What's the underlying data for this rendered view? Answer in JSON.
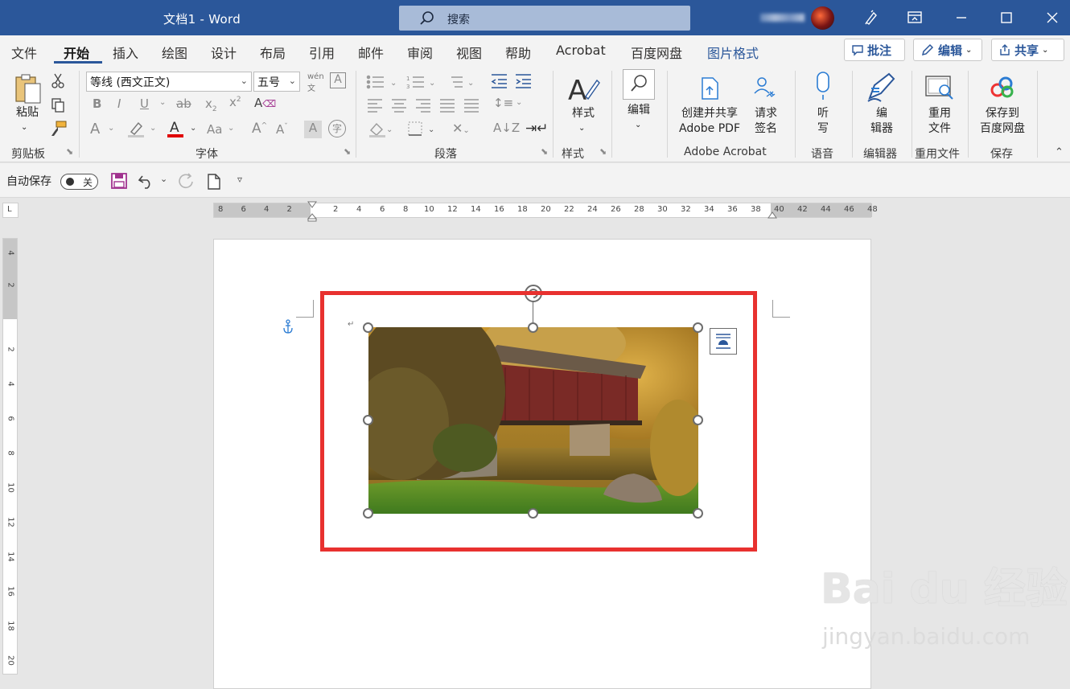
{
  "window": {
    "title": "文档1 - Word",
    "search_placeholder": "搜索"
  },
  "tabs": [
    "文件",
    "开始",
    "插入",
    "绘图",
    "设计",
    "布局",
    "引用",
    "邮件",
    "审阅",
    "视图",
    "帮助",
    "Acrobat",
    "百度网盘",
    "图片格式"
  ],
  "active_tab": "开始",
  "header_buttons": {
    "comment": "批注",
    "edit": "编辑",
    "share": "共享"
  },
  "ribbon": {
    "clipboard": {
      "paste": "粘贴",
      "label": "剪贴板"
    },
    "font": {
      "name": "等线 (西文正文)",
      "size": "五号",
      "label": "字体"
    },
    "paragraph": {
      "label": "段落"
    },
    "styles": {
      "button": "样式",
      "label": "样式"
    },
    "editing": {
      "button": "编辑"
    },
    "acrobat": {
      "create_pdf_l1": "创建并共享",
      "create_pdf_l2": "Adobe PDF",
      "sign_l1": "请求",
      "sign_l2": "签名",
      "label": "Adobe Acrobat"
    },
    "voice": {
      "dictate_l1": "听",
      "dictate_l2": "写",
      "label": "语音"
    },
    "editor": {
      "button_l1": "编",
      "button_l2": "辑器",
      "label": "编辑器"
    },
    "reuse": {
      "button_l1": "重用",
      "button_l2": "文件",
      "label": "重用文件"
    },
    "save": {
      "button_l1": "保存到",
      "button_l2": "百度网盘",
      "label": "保存"
    }
  },
  "qat": {
    "autosave_label": "自动保存",
    "autosave_state": "关"
  },
  "ruler_h": [
    "8",
    "6",
    "4",
    "2",
    "2",
    "4",
    "6",
    "8",
    "10",
    "12",
    "14",
    "16",
    "18",
    "20",
    "22",
    "24",
    "26",
    "28",
    "30",
    "32",
    "34",
    "36",
    "38",
    "40",
    "42",
    "44",
    "46",
    "48"
  ],
  "ruler_v": [
    "4",
    "2",
    "2",
    "4",
    "6",
    "8",
    "10",
    "12",
    "14",
    "16",
    "18",
    "20"
  ],
  "watermark": {
    "main": "Bai du 经验",
    "sub": "jingyan.baidu.com"
  },
  "colors": {
    "title_bar": "#2b579a",
    "highlight_box": "#e8312f",
    "accent": "#2b579a"
  }
}
